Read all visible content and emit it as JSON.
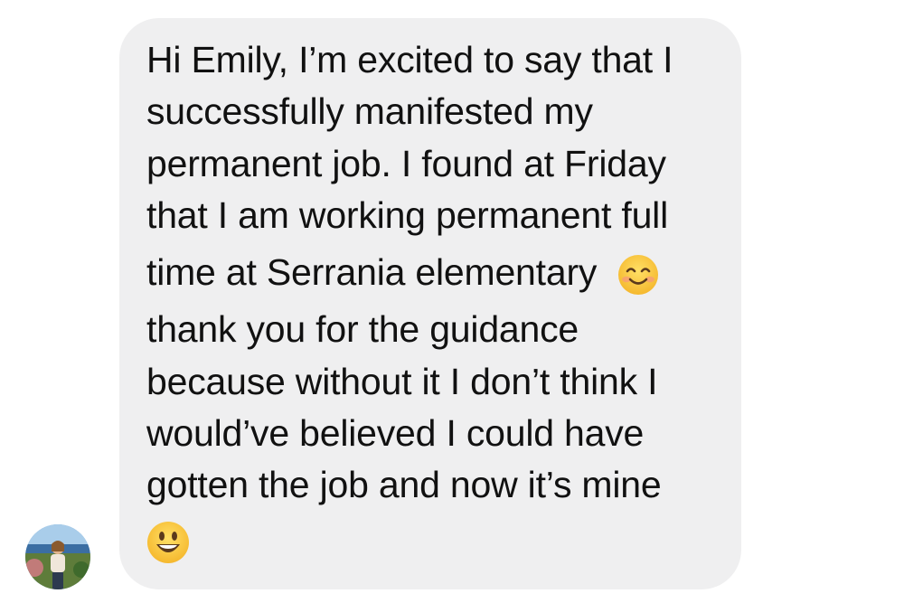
{
  "message": {
    "lines": [
      "Hi Emily, I’m excited to say that I",
      "successfully manifested my",
      "permanent job. I found at Friday",
      "that I am working permanent full",
      "time at Serrania elementary",
      "thank you for the guidance",
      "because without it I don’t think I",
      "would’ve believed I could have",
      "gotten the job and now it’s mine"
    ],
    "emoji_1": "smiling-face-with-smiling-eyes-icon",
    "emoji_2": "grinning-face-with-big-eyes-icon"
  },
  "colors": {
    "bubble_bg": "#efeff0",
    "text": "#111111",
    "page_bg": "#ffffff",
    "emoji_yellow": "#f7c23b"
  },
  "sender": {
    "avatar_icon": "profile-photo-icon"
  }
}
